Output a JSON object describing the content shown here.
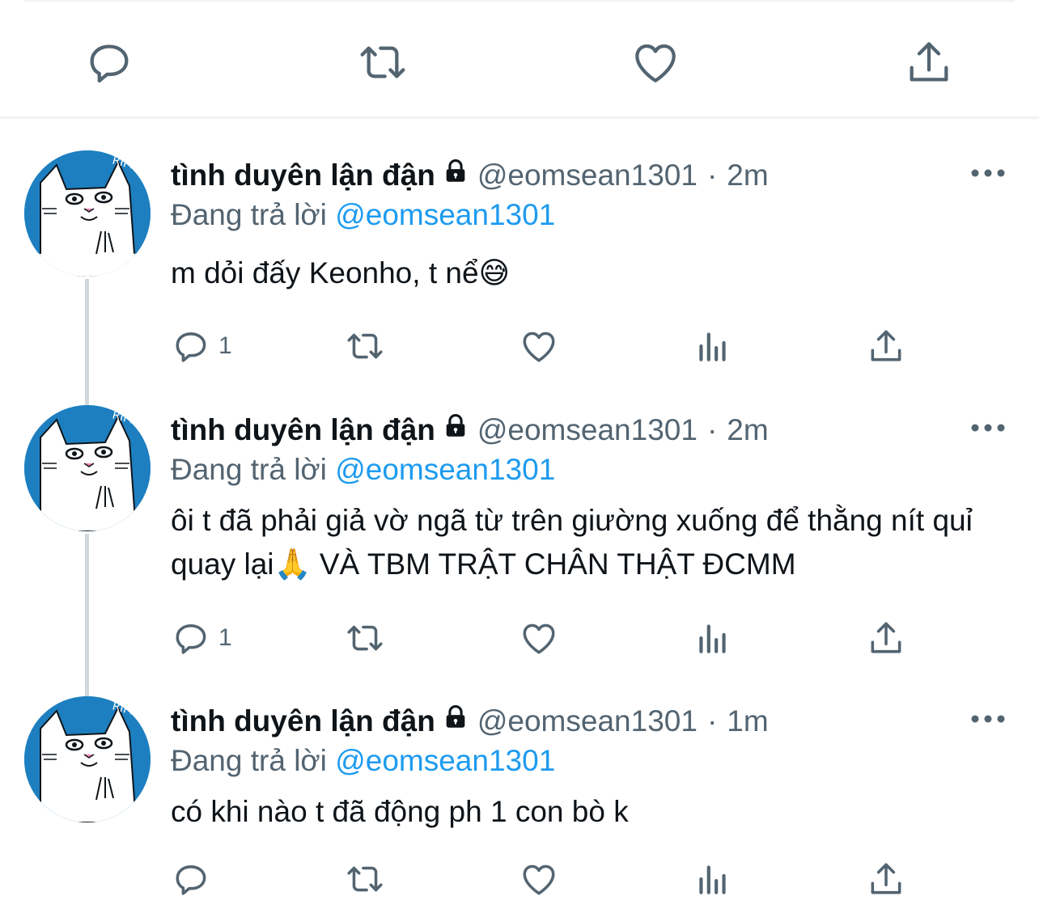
{
  "top_actions": {
    "reply": "reply-icon",
    "retweet": "retweet-icon",
    "like": "heart-icon",
    "share": "share-icon"
  },
  "colors": {
    "accent": "#1d9bf0",
    "secondary_text": "#536471",
    "icon": "#536471",
    "avatar_bg": "#1d7fc0"
  },
  "tweets": [
    {
      "name": "tình duyên lận đận",
      "handle": "@eomsean1301",
      "separator": "·",
      "time": "2m",
      "reply_prefix": "Đang trả lời",
      "reply_mention": "@eomsean1301",
      "text": "m dỏi đấy Keonho, t nể😅",
      "reply_count": "1"
    },
    {
      "name": "tình duyên lận đận",
      "handle": "@eomsean1301",
      "separator": "·",
      "time": "2m",
      "reply_prefix": "Đang trả lời",
      "reply_mention": "@eomsean1301",
      "text": "ôi t đã phải giả vờ ngã từ trên giường xuống để thằng nít quỉ quay lại🙏 VÀ TBM TRẬT CHÂN THẬT ĐCMM",
      "reply_count": "1"
    },
    {
      "name": "tình duyên lận đận",
      "handle": "@eomsean1301",
      "separator": "·",
      "time": "1m",
      "reply_prefix": "Đang trả lời",
      "reply_mention": "@eomsean1301",
      "text": "có khi nào t đã động ph 1 con bò k",
      "reply_count": ""
    }
  ]
}
